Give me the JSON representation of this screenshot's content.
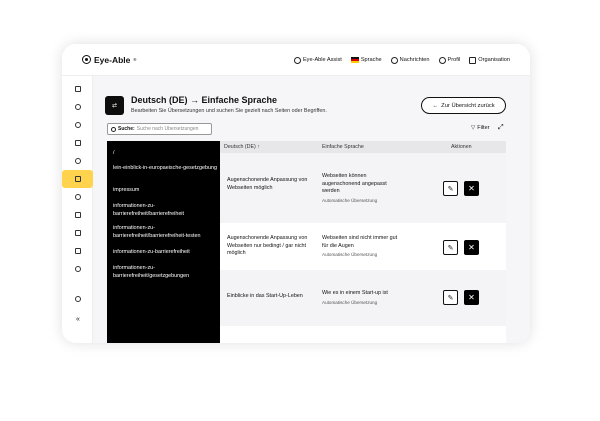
{
  "app": {
    "logo": "Eye-Able",
    "logo_mark": "®"
  },
  "topnav": [
    {
      "label": "Eye-Able Assist",
      "icon": "eye-icon"
    },
    {
      "label": "Sprache",
      "icon": "flag-de-icon"
    },
    {
      "label": "Nachrichten",
      "icon": "bell-icon"
    },
    {
      "label": "Profil",
      "icon": "user-icon"
    },
    {
      "label": "Organisation",
      "icon": "org-icon"
    }
  ],
  "sidebar": [
    "home-icon",
    "info-icon",
    "report-icon",
    "translate-icon",
    "target-icon",
    "thumbs-up-icon",
    "goal-icon",
    "document-icon",
    "chart-icon",
    "file-icon",
    "pie-icon",
    "headset-icon",
    "collapse-icon"
  ],
  "sidebar_glyphs": {
    "collapse-icon": "«"
  },
  "header": {
    "title": "Deutsch (DE) → Einfache Sprache",
    "subtitle": "Bearbeiten Sie Übersetzungen und suchen Sie gezielt nach Seiten oder Begriffen.",
    "back_label": "Zur Übersicht zurück",
    "back_arrow": "←"
  },
  "search": {
    "label": "Suche:",
    "placeholder": "Suche nach Übersetzungen"
  },
  "filter_label": "Filter",
  "expand_glyph": "⤢",
  "paths": [
    "/",
    "lein-einblick-in-europaeische-gesetzgebung",
    "impressum",
    "informationen-zu-barrierefreiheit/barrierefreiheit",
    "informationen-zu-barrierefreiheit/barrierefreiheit-testen",
    "informationen-zu-barrierefreiheit",
    "informationen-zu-barrierefreiheit/gesetzgebungen"
  ],
  "table": {
    "columns": [
      "Deutsch (DE) ↑",
      "Einfache Sprache",
      "Aktionen"
    ],
    "rows": [
      {
        "source": "Augenschonende Anpassung von Webseiten möglich",
        "target": "Webseiten können augenschonend angepasst werden",
        "note": "Automatische Übersetzung"
      },
      {
        "source": "Augenschonende Anpassung von Webseiten nur bedingt / gar nicht möglich",
        "target": "Webseiten sind nicht immer gut für die Augen",
        "note": "Automatische Übersetzung"
      },
      {
        "source": "Einblicke in das Start-Up-Leben",
        "target": "Wie es in einem Start-up ist",
        "note": "Automatische Übersetzung"
      }
    ],
    "edit_glyph": "✎",
    "delete_glyph": "✕"
  }
}
